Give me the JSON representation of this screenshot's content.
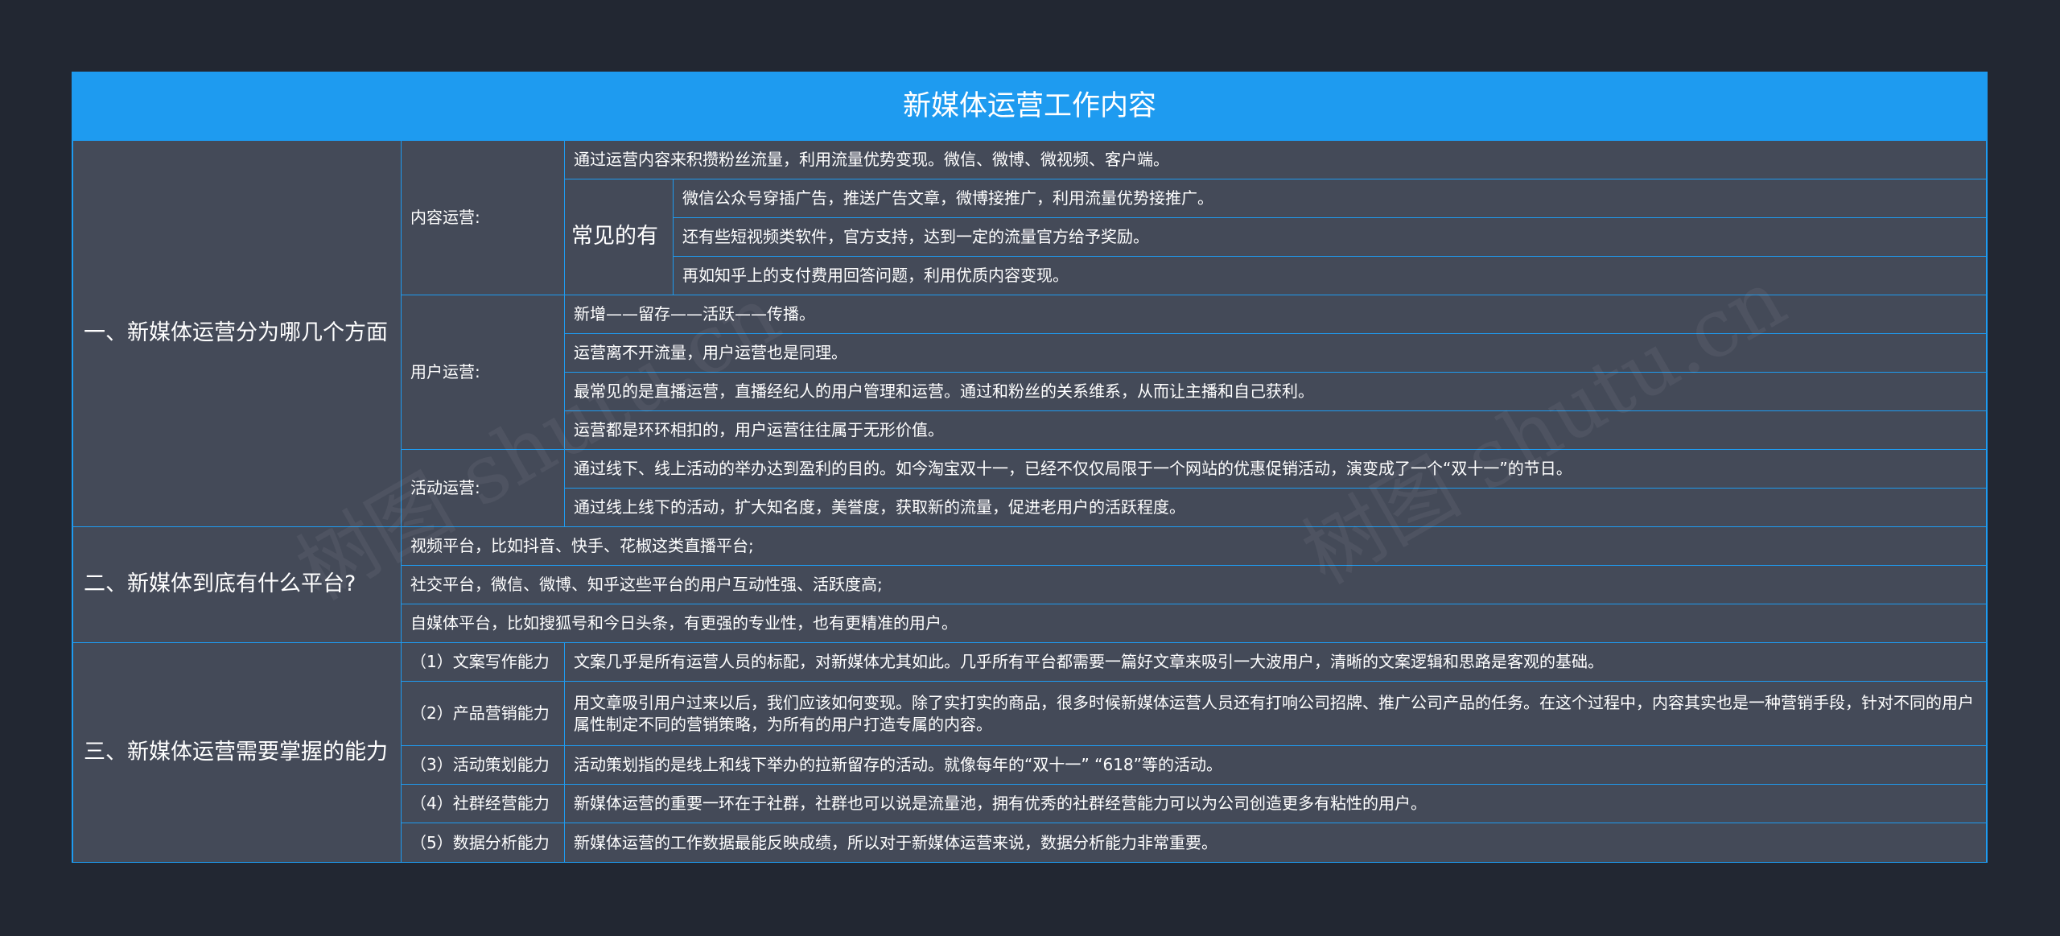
{
  "title": "新媒体运营工作内容",
  "sections": [
    {
      "label": "一、新媒体运营分为哪几个方面",
      "groups": [
        {
          "label": "内容运营:",
          "items": [
            "通过运营内容来积攒粉丝流量，利用流量优势变现。微信、微博、微视频、客户端。"
          ],
          "sub": {
            "label": "常见的有",
            "items": [
              "微信公众号穿插广告，推送广告文章，微博接推广，利用流量优势接推广。",
              "还有些短视频类软件，官方支持，达到一定的流量官方给予奖励。",
              "再如知乎上的支付费用回答问题，利用优质内容变现。"
            ]
          }
        },
        {
          "label": "用户运营:",
          "items": [
            "新增——留存——活跃——传播。",
            "运营离不开流量，用户运营也是同理。",
            "最常见的是直播运营，直播经纪人的用户管理和运营。通过和粉丝的关系维系，从而让主播和自己获利。",
            "运营都是环环相扣的，用户运营往往属于无形价值。"
          ]
        },
        {
          "label": "活动运营:",
          "items": [
            "通过线下、线上活动的举办达到盈利的目的。如今淘宝双十一，已经不仅仅局限于一个网站的优惠促销活动，演变成了一个“双十一”的节日。",
            "通过线上线下的活动，扩大知名度，美誉度，获取新的流量，促进老用户的活跃程度。"
          ]
        }
      ]
    },
    {
      "label": "二、新媒体到底有什么平台?",
      "items": [
        "视频平台，比如抖音、快手、花椒这类直播平台;",
        "社交平台，微信、微博、知乎这些平台的用户互动性强、活跃度高;",
        "自媒体平台，比如搜狐号和今日头条，有更强的专业性，也有更精准的用户。"
      ]
    },
    {
      "label": "三、新媒体运营需要掌握的能力",
      "abilities": [
        {
          "label": "（1）文案写作能力",
          "text": "文案几乎是所有运营人员的标配，对新媒体尤其如此。几乎所有平台都需要一篇好文章来吸引一大波用户，清晰的文案逻辑和思路是客观的基础。"
        },
        {
          "label": "（2）产品营销能力",
          "text": "用文章吸引用户过来以后，我们应该如何变现。除了实打实的商品，很多时候新媒体运营人员还有打响公司招牌、推广公司产品的任务。在这个过程中，内容其实也是一种营销手段，针对不同的用户属性制定不同的营销策略，为所有的用户打造专属的内容。"
        },
        {
          "label": "（3）活动策划能力",
          "text": "活动策划指的是线上和线下举办的拉新留存的活动。就像每年的“双十一” “618”等的活动。"
        },
        {
          "label": "（4）社群经营能力",
          "text": "新媒体运营的重要一环在于社群，社群也可以说是流量池，拥有优秀的社群经营能力可以为公司创造更多有粘性的用户。"
        },
        {
          "label": "（5）数据分析能力",
          "text": "新媒体运营的工作数据最能反映成绩，所以对于新媒体运营来说，数据分析能力非常重要。"
        }
      ]
    }
  ],
  "watermark": "树图 shutu.cn"
}
